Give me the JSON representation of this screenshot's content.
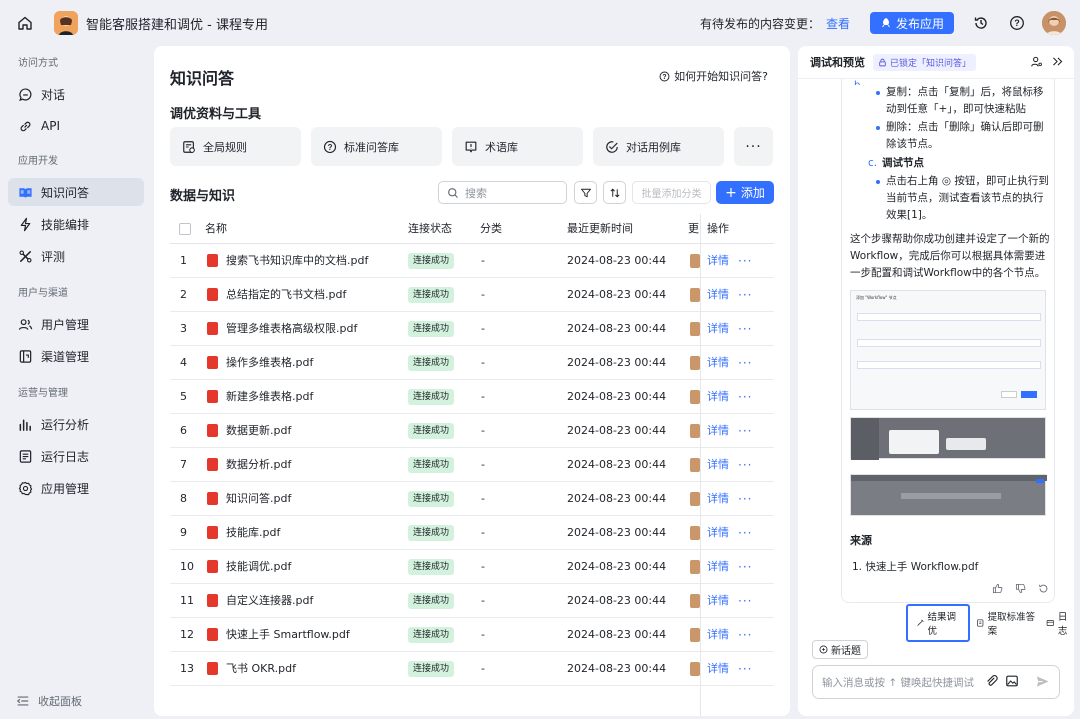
{
  "topbar": {
    "app_title": "智能客服搭建和调优 - 课程专用",
    "pending_label": "有待发布的内容变更：",
    "view_link": "查看",
    "publish_button": "发布应用",
    "icons": [
      "home-icon",
      "history-icon",
      "help-icon"
    ]
  },
  "sidebar": {
    "sections": [
      {
        "title": "访问方式",
        "items": [
          {
            "label": "对话",
            "icon": "chat-icon"
          },
          {
            "label": "API",
            "icon": "link-icon"
          }
        ]
      },
      {
        "title": "应用开发",
        "items": [
          {
            "label": "知识问答",
            "icon": "book-icon",
            "active": true
          },
          {
            "label": "技能编排",
            "icon": "flash-icon"
          },
          {
            "label": "评测",
            "icon": "tools-icon"
          }
        ]
      },
      {
        "title": "用户与渠道",
        "items": [
          {
            "label": "用户管理",
            "icon": "users-icon"
          },
          {
            "label": "渠道管理",
            "icon": "channel-icon"
          }
        ]
      },
      {
        "title": "运营与管理",
        "items": [
          {
            "label": "运行分析",
            "icon": "bar-chart-icon"
          },
          {
            "label": "运行日志",
            "icon": "log-icon"
          },
          {
            "label": "应用管理",
            "icon": "gear-icon"
          }
        ]
      }
    ],
    "collapse_label": "收起面板"
  },
  "main": {
    "title": "知识问答",
    "help_link": "如何开始知识问答?",
    "tools_title": "调优资料与工具",
    "tools": [
      "全局规则",
      "标准问答库",
      "术语库",
      "对话用例库"
    ],
    "more_symbol": "···",
    "data_title": "数据与知识",
    "search_placeholder": "搜索",
    "batch_label": "批量添加分类",
    "add_button": "添加",
    "columns": {
      "name": "名称",
      "status": "连接状态",
      "category": "分类",
      "updated": "最近更新时间",
      "updater": "更",
      "ops": "操作"
    },
    "rows": [
      {
        "n": "1",
        "name": "搜索飞书知识库中的文档.pdf",
        "status": "连接成功",
        "cat": "-",
        "time": "2024-08-23 00:44",
        "detail": "详情",
        "more": "···"
      },
      {
        "n": "2",
        "name": "总结指定的飞书文档.pdf",
        "status": "连接成功",
        "cat": "-",
        "time": "2024-08-23 00:44",
        "detail": "详情",
        "more": "···"
      },
      {
        "n": "3",
        "name": "管理多维表格高级权限.pdf",
        "status": "连接成功",
        "cat": "-",
        "time": "2024-08-23 00:44",
        "detail": "详情",
        "more": "···"
      },
      {
        "n": "4",
        "name": "操作多维表格.pdf",
        "status": "连接成功",
        "cat": "-",
        "time": "2024-08-23 00:44",
        "detail": "详情",
        "more": "···"
      },
      {
        "n": "5",
        "name": "新建多维表格.pdf",
        "status": "连接成功",
        "cat": "-",
        "time": "2024-08-23 00:44",
        "detail": "详情",
        "more": "···"
      },
      {
        "n": "6",
        "name": "数据更新.pdf",
        "status": "连接成功",
        "cat": "-",
        "time": "2024-08-23 00:44",
        "detail": "详情",
        "more": "···"
      },
      {
        "n": "7",
        "name": "数据分析.pdf",
        "status": "连接成功",
        "cat": "-",
        "time": "2024-08-23 00:44",
        "detail": "详情",
        "more": "···"
      },
      {
        "n": "8",
        "name": "知识问答.pdf",
        "status": "连接成功",
        "cat": "-",
        "time": "2024-08-23 00:44",
        "detail": "详情",
        "more": "···"
      },
      {
        "n": "9",
        "name": "技能库.pdf",
        "status": "连接成功",
        "cat": "-",
        "time": "2024-08-23 00:44",
        "detail": "详情",
        "more": "···"
      },
      {
        "n": "10",
        "name": "技能调优.pdf",
        "status": "连接成功",
        "cat": "-",
        "time": "2024-08-23 00:44",
        "detail": "详情",
        "more": "···"
      },
      {
        "n": "11",
        "name": "自定义连接器.pdf",
        "status": "连接成功",
        "cat": "-",
        "time": "2024-08-23 00:44",
        "detail": "详情",
        "more": "···"
      },
      {
        "n": "12",
        "name": "快速上手 Smartflow.pdf",
        "status": "连接成功",
        "cat": "-",
        "time": "2024-08-23 00:44",
        "detail": "详情",
        "more": "···"
      },
      {
        "n": "13",
        "name": "飞书 OKR.pdf",
        "status": "连接成功",
        "cat": "-",
        "time": "2024-08-23 00:44",
        "detail": "详情",
        "more": "···"
      }
    ]
  },
  "right": {
    "title": "调试和预览",
    "lock_badge": "已锁定「知识问答」",
    "bullets": [
      "复制：点击「复制」后，将鼠标移动到任意「+」，即可快速粘贴",
      "删除：点击「删除」确认后即可删除该节点。"
    ],
    "sub_c_label": "c.",
    "sub_c_title": "调试节点",
    "bullet3": "点击右上角 ◎ 按钮，即可止执行到当前节点，测试查看该节点的执行效果[1]。",
    "paragraph": "这个步骤帮助你成功创建并设定了一个新的Workflow，完成后你可以根据具体需要进一步配置和调试Workflow中的各个节点。",
    "dialog_title": "添加 \"Workflow\" 节点",
    "source_title": "来源",
    "source_item": "1. 快速上手 Workflow.pdf",
    "actions": {
      "result": "结果调优",
      "extract": "提取标准答案",
      "log": "日志"
    },
    "new_topic": "新话题",
    "input_placeholder": "输入消息或按 ↑ 键唤起快捷调试"
  }
}
